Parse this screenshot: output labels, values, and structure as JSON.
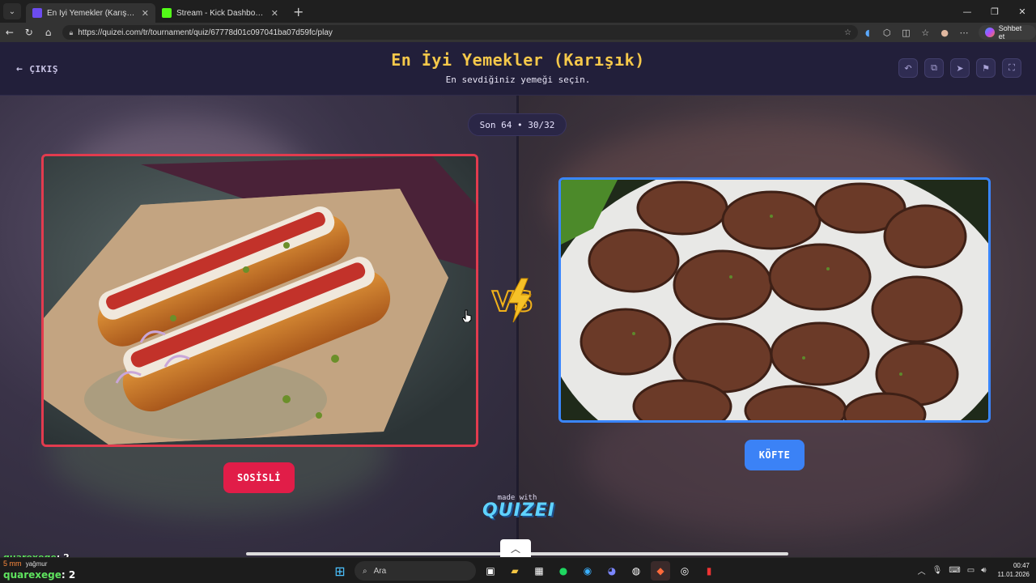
{
  "browser": {
    "tabs": [
      {
        "title": "En İyi Yemekler (Karışık) - Tier List",
        "active": true,
        "favicon_color": "#6c4cf0"
      },
      {
        "title": "Stream - Kick Dashboard",
        "active": false,
        "favicon_color": "#53fc18"
      }
    ],
    "url": "https://quizei.com/tr/tournament/quiz/67778d01c097041ba07d59fc/play",
    "copilot_label": "Sohbet et"
  },
  "header": {
    "exit_label": "ÇIKIŞ",
    "title": "En İyi Yemekler (Karışık)",
    "subtitle": "En sevdiğiniz yemeği seçin.",
    "icons": [
      "undo-icon",
      "share-icon",
      "send-icon",
      "flag-icon",
      "fullscreen-icon"
    ]
  },
  "round": {
    "label": "Son 64 • 30/32"
  },
  "choices": {
    "left": {
      "label": "SOSİSLİ",
      "accent": "#e23b4e"
    },
    "right": {
      "label": "KÖFTE",
      "accent": "#3a86ff"
    }
  },
  "footer": {
    "made_with": "made with",
    "brand": "QUIZEI"
  },
  "overlay": {
    "chat_user": "quarexege",
    "chat_count": ": 2"
  },
  "taskbar": {
    "weather_temp": "5 mm",
    "weather_text": "yağmur",
    "search_placeholder": "Ara",
    "time": "00:47",
    "date": "11.01.2026"
  }
}
